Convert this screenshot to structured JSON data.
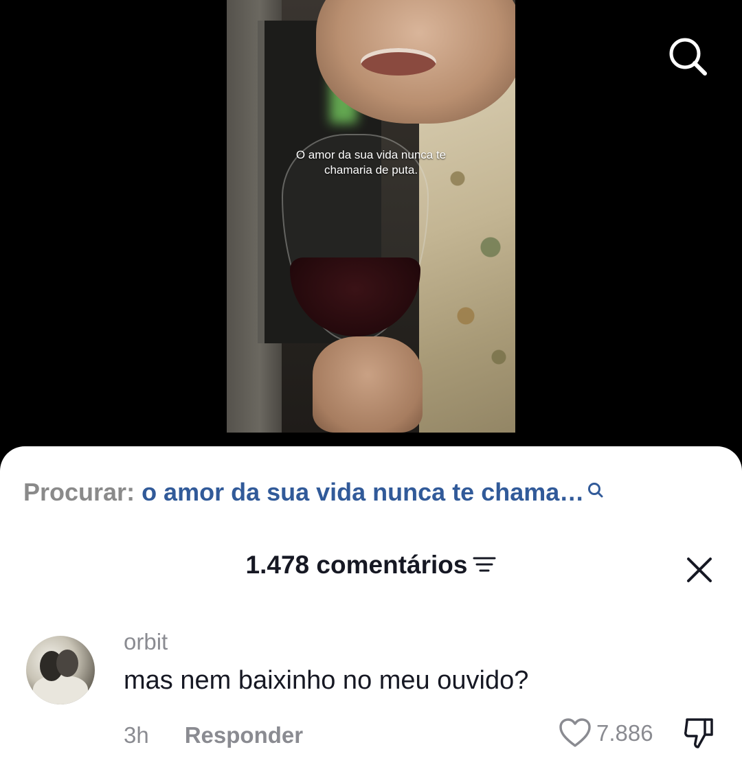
{
  "video": {
    "caption": "O amor da sua vida nunca te chamaria de puta."
  },
  "top_bar": {
    "search_icon": "search-icon"
  },
  "search_suggestion": {
    "prefix": "Procurar:",
    "query": "o amor da sua vida nunca te chama…",
    "icon": "search-icon",
    "query_color": "#315a99"
  },
  "comments_header": {
    "count_label": "1.478 comentários",
    "filter_icon": "filter-icon",
    "close_icon": "close-icon"
  },
  "comments": [
    {
      "username": "orbit",
      "text": "mas nem baixinho no meu ouvido?",
      "time": "3h",
      "reply_label": "Responder",
      "likes": "7.886",
      "like_icon": "heart-icon",
      "dislike_icon": "thumbs-down-icon"
    }
  ]
}
